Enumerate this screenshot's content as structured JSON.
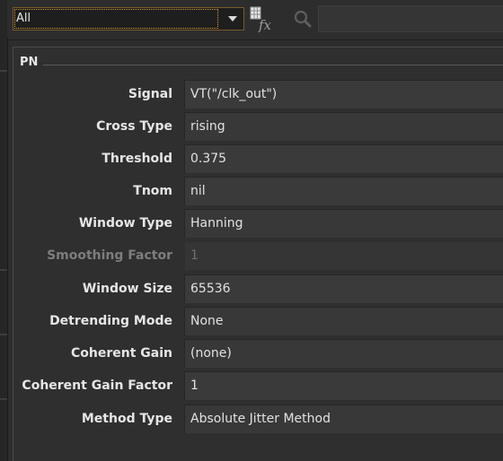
{
  "toolbar": {
    "filter_value": "All",
    "icons": {
      "dropdown": "chevron-down-icon",
      "function": "fx-icon",
      "search": "magnifier-icon"
    }
  },
  "group": {
    "title": "PN"
  },
  "fields": [
    {
      "label": "Signal",
      "value": "VT(\"/clk_out\")",
      "enabled": true
    },
    {
      "label": "Cross Type",
      "value": "rising",
      "enabled": true
    },
    {
      "label": "Threshold",
      "value": "0.375",
      "enabled": true
    },
    {
      "label": "Tnom",
      "value": "nil",
      "enabled": true
    },
    {
      "label": "Window Type",
      "value": "Hanning",
      "enabled": true
    },
    {
      "label": "Smoothing Factor",
      "value": "1",
      "enabled": false
    },
    {
      "label": "Window Size",
      "value": "65536",
      "enabled": true
    },
    {
      "label": "Detrending Mode",
      "value": "None",
      "enabled": true
    },
    {
      "label": "Coherent Gain",
      "value": "(none)",
      "enabled": true
    },
    {
      "label": "Coherent Gain Factor",
      "value": "1",
      "enabled": true
    },
    {
      "label": "Method Type",
      "value": "Absolute Jitter Method",
      "enabled": true
    }
  ],
  "colors": {
    "background": "#2d2d2d",
    "field": "#3a3a3a",
    "label": "#e6e6e6",
    "disabled_label": "#7d7d7d",
    "focus_accent": "#d89a3a"
  }
}
